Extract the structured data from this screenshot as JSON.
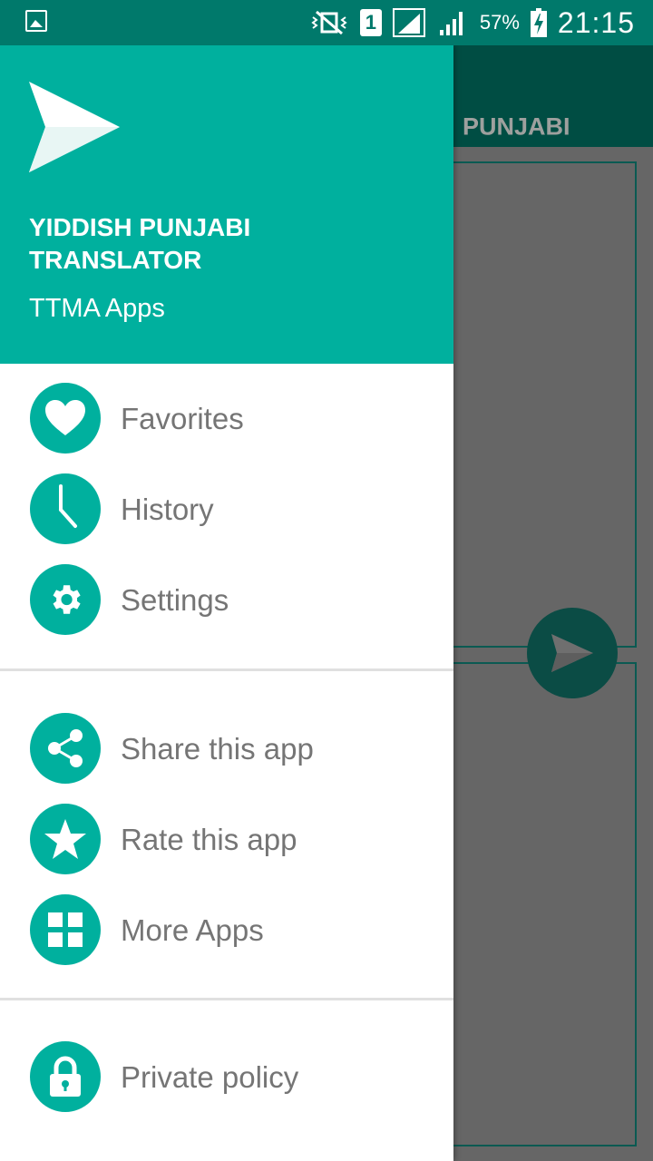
{
  "status_bar": {
    "battery_percent": "57%",
    "time": "21:15",
    "sim_label": "1"
  },
  "app": {
    "toolbar_language": "PUNJABI"
  },
  "drawer": {
    "title": "YIDDISH PUNJABI TRANSLATOR",
    "subtitle": "TTMA Apps",
    "section1": [
      {
        "label": "Favorites",
        "icon": "heart-icon"
      },
      {
        "label": "History",
        "icon": "clock-icon"
      },
      {
        "label": "Settings",
        "icon": "gear-icon"
      }
    ],
    "section2": [
      {
        "label": "Share this app",
        "icon": "share-icon"
      },
      {
        "label": "Rate this app",
        "icon": "star-icon"
      },
      {
        "label": "More Apps",
        "icon": "grid-icon"
      }
    ],
    "section3": [
      {
        "label": "Private policy",
        "icon": "lock-icon"
      }
    ]
  },
  "colors": {
    "accent": "#00b09e",
    "status_bar": "#00796b",
    "toolbar_dark": "#004d43",
    "menu_text": "#757575"
  }
}
